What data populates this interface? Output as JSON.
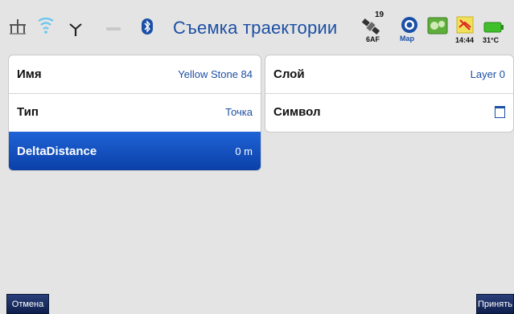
{
  "statusbar": {
    "title": "Съемка траектории",
    "satellite_count": "19",
    "satellite_sub": "6AF",
    "map_label": "Map",
    "time": "14:44",
    "temperature": "31°C"
  },
  "left_panel": {
    "rows": [
      {
        "label": "Имя",
        "value": "Yellow Stone 84"
      },
      {
        "label": "Тип",
        "value": "Точка"
      },
      {
        "label": "DeltaDistance",
        "value": "0 m"
      }
    ]
  },
  "right_panel": {
    "rows": [
      {
        "label": "Слой",
        "value": "Layer 0"
      },
      {
        "label": "Символ",
        "value": ""
      }
    ]
  },
  "buttons": {
    "cancel": "Отмена",
    "accept": "Принять"
  },
  "colors": {
    "accent": "#1d4fa3",
    "selected_row": "#0b40a8",
    "background": "#e4e4e4"
  }
}
